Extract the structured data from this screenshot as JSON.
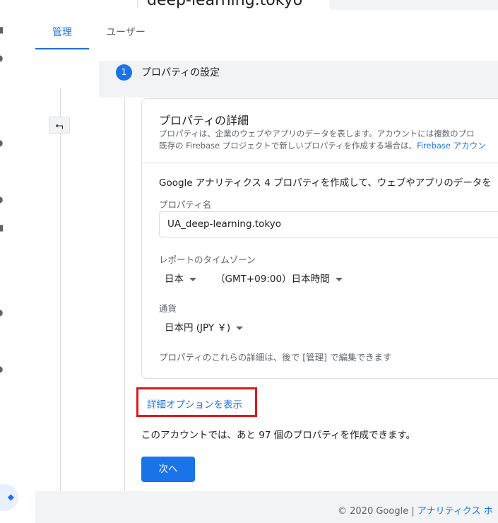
{
  "header": {
    "account_title": "deep-learning.tokyo"
  },
  "tabs": [
    {
      "label": "管理"
    },
    {
      "label": "ユーザー"
    }
  ],
  "step": {
    "number": "1",
    "title": "プロパティの設定"
  },
  "back_icon": "⮢",
  "icons": {
    "back": "arrow-back-icon"
  },
  "card": {
    "title": "プロパティの詳細",
    "desc_line1": "プロパティは、企業のウェブやアプリのデータを表します。アカウントには複数のプロ",
    "desc_line2": "既存の Firebase プロジェクトで新しいプロパティを作成する場合は、",
    "desc_link": "Firebase アカウン",
    "ga4_text": "Google アナリティクス 4 プロパティを作成して、ウェブやアプリのデータを",
    "property_name_label": "プロパティ名",
    "property_name_value": "UA_deep-learning.tokyo",
    "timezone_label": "レポートのタイムゾーン",
    "timezone_country": "日本",
    "timezone_value": "（GMT+09:00）日本時間",
    "currency_label": "通貨",
    "currency_value": "日本円 (JPY ￥)",
    "footnote": "プロパティのこれらの詳細は、後で [管理] で編集できます"
  },
  "advanced_link": "詳細オプションを表示",
  "remaining_text": "このアカウントでは、あと 97 個のプロパティを作成できます。",
  "next_button": "次へ",
  "footer": {
    "copyright": "© 2020 Google",
    "separator": "|",
    "link": "アナリティクス ホ"
  },
  "colors": {
    "accent": "#1a73e8",
    "highlight": "#e0181c"
  }
}
